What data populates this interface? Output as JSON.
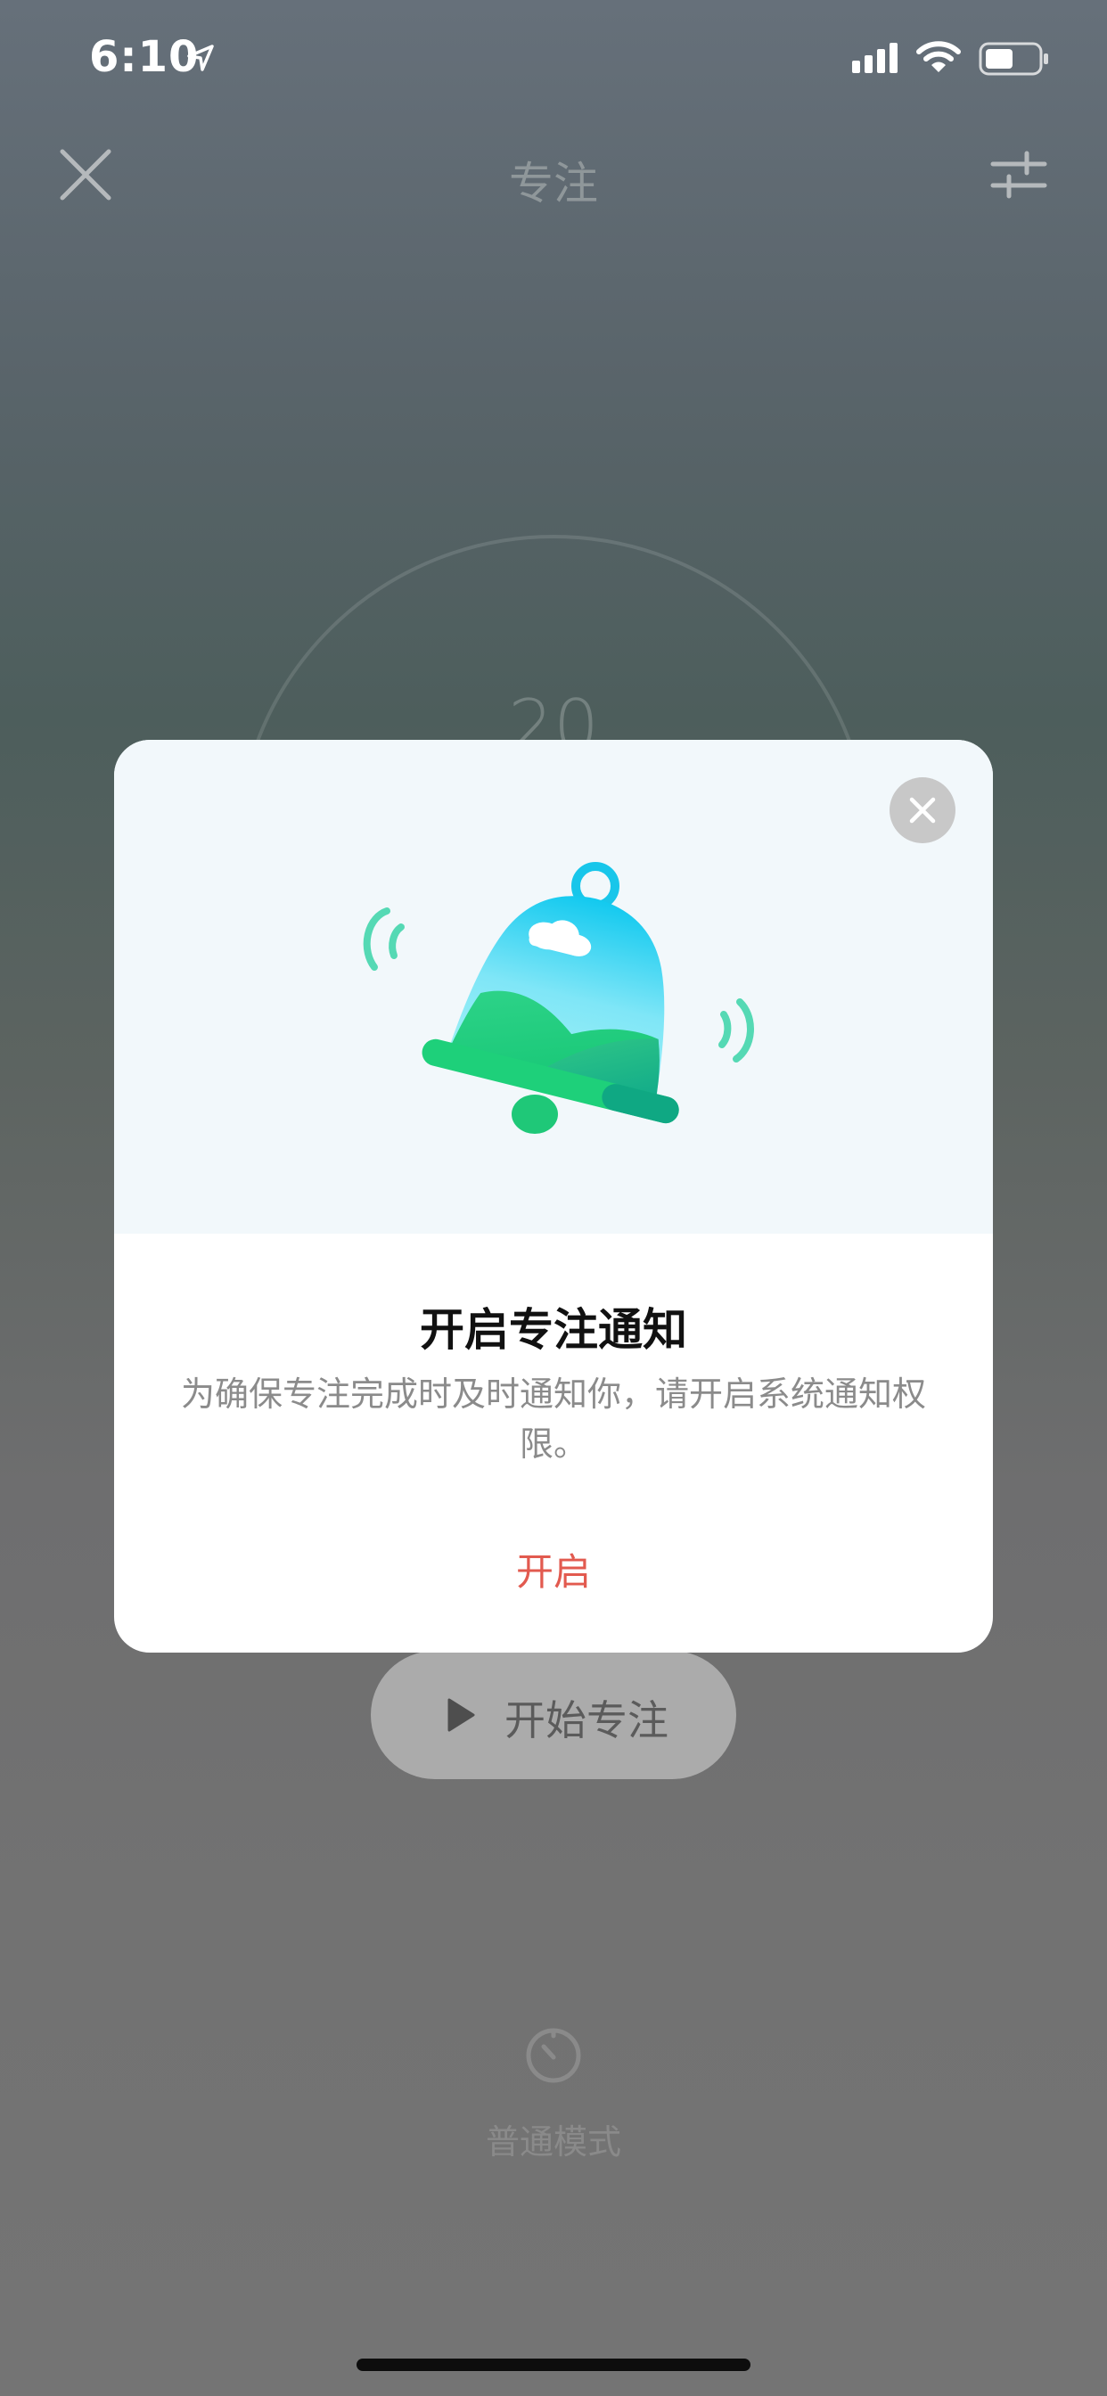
{
  "status_bar": {
    "time": "6:10"
  },
  "nav": {
    "title": "专注"
  },
  "background": {
    "timer_value": "20",
    "start_button_label": "开始专注",
    "mode_label": "普通模式"
  },
  "dialog": {
    "title": "开启专注通知",
    "message": "为确保专注完成时及时通知你，请开启系统通知权限。",
    "action_label": "开启"
  },
  "colors": {
    "action": "#e25a4f",
    "bell_top": "#2fd9f2",
    "bell_bottom": "#1ed07a"
  },
  "icons": [
    "location-arrow-icon",
    "signal-icon",
    "wifi-icon",
    "battery-icon",
    "close-icon",
    "settings-sliders-icon",
    "play-icon",
    "timer-icon",
    "bell-icon"
  ]
}
